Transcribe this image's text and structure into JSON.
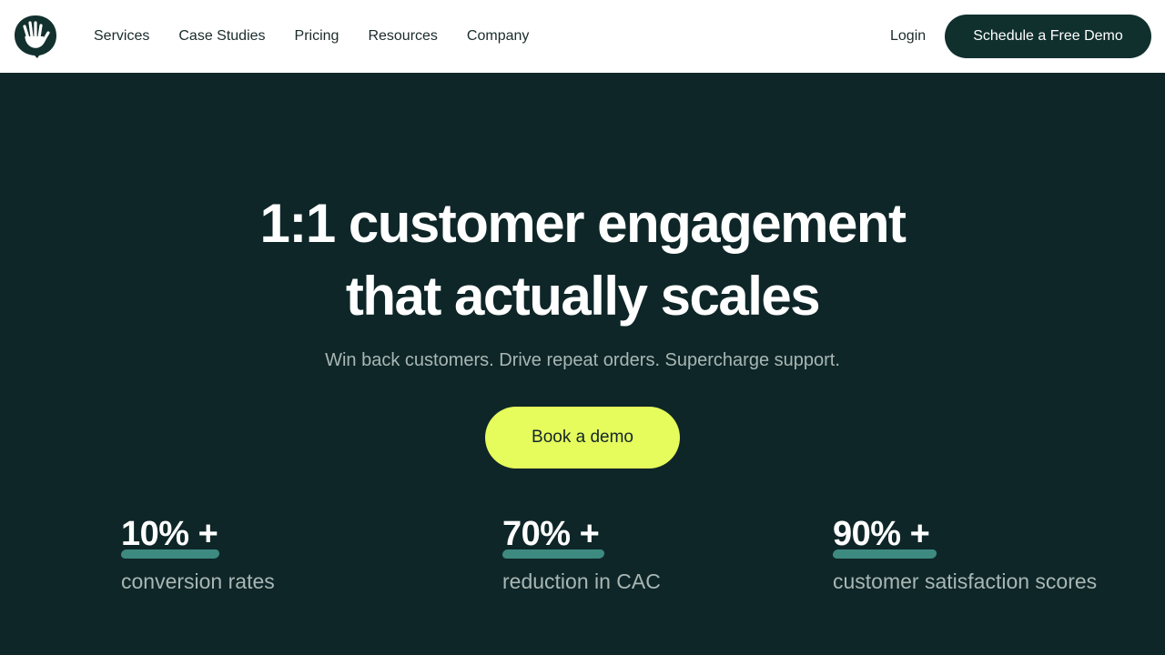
{
  "nav": {
    "links": [
      "Services",
      "Case Studies",
      "Pricing",
      "Resources",
      "Company"
    ],
    "login": "Login",
    "cta": "Schedule a Free Demo"
  },
  "hero": {
    "title_line1": "1:1 customer engagement",
    "title_line2": "that actually scales",
    "subtitle": "Win back customers. Drive repeat orders. Supercharge support.",
    "button": "Book a demo"
  },
  "stats": [
    {
      "value": "10% +",
      "label": "conversion rates"
    },
    {
      "value": "70% +",
      "label": "reduction in CAC"
    },
    {
      "value": "90% +",
      "label": "customer satisfaction scores"
    }
  ],
  "colors": {
    "background": "#0e2628",
    "accent": "#e6fb5c",
    "underline": "#3d8a80",
    "nav_button": "#10302e"
  },
  "icons": {
    "logo": "waving-hand-icon"
  }
}
